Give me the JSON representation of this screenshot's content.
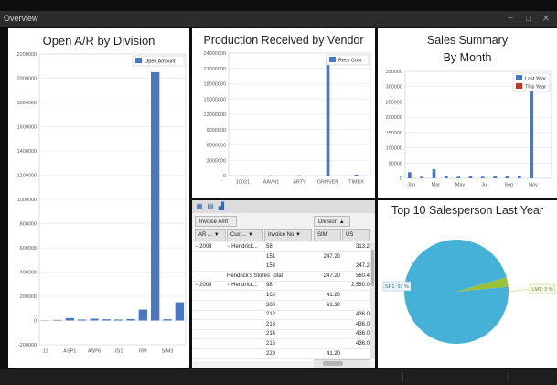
{
  "window": {
    "title": "Overview",
    "minimize_icon": "minimize-icon",
    "maximize_icon": "maximize-icon",
    "close_icon": "close-icon"
  },
  "colors": {
    "bar_blue": "#4a76c2",
    "bar_red": "#c0392b",
    "pie_blue": "#45b1d6",
    "pie_green": "#9bc13c"
  },
  "chart_data": [
    {
      "id": "open_ar",
      "type": "bar",
      "title": "Open A/R by Division",
      "legend": [
        "Open Amount"
      ],
      "legend_position": "top-right",
      "ylim": [
        -200000,
        2200000
      ],
      "yticks": [
        -200000,
        0,
        200000,
        400000,
        600000,
        800000,
        1000000,
        1200000,
        1400000,
        1600000,
        1800000,
        2000000,
        2200000
      ],
      "ytick_labels": [
        "-200000",
        "0",
        "200000",
        "400000",
        "600000",
        "800000",
        "1000000",
        "1200000",
        "1400000",
        "1600000",
        "1800000",
        "2000000",
        "2200000"
      ],
      "xtick_labels": [
        "11",
        "ASP1",
        "ASP6",
        "JS1",
        "RM",
        "SIM3"
      ],
      "categories": [
        "11",
        "",
        "ASP1",
        "",
        "ASP6",
        "",
        "JS1",
        "",
        "RM",
        "",
        "SIM3",
        ""
      ],
      "series": [
        {
          "name": "Open Amount",
          "values": [
            2000,
            5000,
            20000,
            8000,
            15000,
            10000,
            8000,
            12000,
            90000,
            2050000,
            10000,
            150000
          ]
        }
      ],
      "grid": true
    },
    {
      "id": "production",
      "type": "bar",
      "title": "Production Received by Vendor",
      "legend": [
        "Recv Cost"
      ],
      "legend_position": "top-right",
      "ylim": [
        0,
        24000000
      ],
      "yticks": [
        0,
        3000000,
        6000000,
        9000000,
        12000000,
        15000000,
        18000000,
        21000000,
        24000000
      ],
      "ytick_labels": [
        "0",
        "3000000",
        "6000000",
        "9000000",
        "12000000",
        "15000000",
        "18000000",
        "21000000",
        "24000000"
      ],
      "categories": [
        "10021",
        "AAVN1",
        "ARTV",
        "GRNVEN",
        "TIMEX"
      ],
      "series": [
        {
          "name": "Recv Cost",
          "values": [
            30000,
            40000,
            60000,
            22700000,
            200000
          ]
        }
      ],
      "grid": true
    },
    {
      "id": "sales_summary",
      "type": "bar",
      "title": "Sales Summary",
      "subtitle": "By Month",
      "legend": [
        "Last Year",
        "This Year"
      ],
      "legend_position": "top-right",
      "ylim": [
        0,
        350000
      ],
      "yticks": [
        0,
        50000,
        100000,
        150000,
        200000,
        250000,
        300000,
        350000
      ],
      "ytick_labels": [
        "0",
        "50000",
        "100000",
        "150000",
        "200000",
        "250000",
        "300000",
        "350000"
      ],
      "xtick_labels": [
        "Jan",
        "Mar",
        "May",
        "Jul",
        "Sep",
        "Nov"
      ],
      "categories": [
        "Jan",
        "Feb",
        "Mar",
        "Apr",
        "May",
        "Jun",
        "Jul",
        "Aug",
        "Sep",
        "Oct",
        "Nov",
        "Dec"
      ],
      "series": [
        {
          "name": "Last Year",
          "values": [
            20000,
            5000,
            30000,
            8000,
            5000,
            6000,
            5000,
            6000,
            7000,
            6000,
            315000,
            0
          ]
        },
        {
          "name": "This Year",
          "values": [
            0,
            0,
            0,
            0,
            0,
            0,
            0,
            0,
            0,
            0,
            0,
            0
          ]
        }
      ],
      "grid": true
    },
    {
      "id": "top_salesperson",
      "type": "pie",
      "title": "Top 10 Salesperson Last Year",
      "slices": [
        {
          "label": "SP1: 97 %",
          "value": 97
        },
        {
          "label": "LM1: 3 %",
          "value": 3
        }
      ]
    }
  ],
  "pivot": {
    "toolbar_icons": [
      "layout-icon",
      "grid-icon",
      "chart-icon"
    ],
    "data_field": "Invoice Amt",
    "column_field": "Division",
    "column_field_arrow": "▲",
    "row_headers": [
      "AR ...",
      "Cust...",
      "Invoice No"
    ],
    "row_header_arrows": [
      "▼",
      "▼",
      "▼"
    ],
    "value_columns": [
      "SIM",
      "US"
    ],
    "rows": [
      {
        "y1": "− 2008",
        "y2": "− Hendrick...",
        "inv": "58",
        "sim": "",
        "us": "313.2"
      },
      {
        "y1": "",
        "y2": "",
        "inv": "151",
        "sim": "247.20",
        "us": ""
      },
      {
        "y1": "",
        "y2": "",
        "inv": "153",
        "sim": "",
        "us": "247.2"
      },
      {
        "y1": "",
        "y2": "Hendrick's Stores Total",
        "inv": "",
        "sim": "247.20",
        "us": "560.4"
      },
      {
        "y1": "− 2009",
        "y2": "− Hendrick...",
        "inv": "98",
        "sim": "",
        "us": "2,560.0"
      },
      {
        "y1": "",
        "y2": "",
        "inv": "166",
        "sim": "41.20",
        "us": ""
      },
      {
        "y1": "",
        "y2": "",
        "inv": "200",
        "sim": "61.20",
        "us": ""
      },
      {
        "y1": "",
        "y2": "",
        "inv": "212",
        "sim": "",
        "us": "436.0"
      },
      {
        "y1": "",
        "y2": "",
        "inv": "213",
        "sim": "",
        "us": "436.0"
      },
      {
        "y1": "",
        "y2": "",
        "inv": "214",
        "sim": "",
        "us": "436.0"
      },
      {
        "y1": "",
        "y2": "",
        "inv": "215",
        "sim": "",
        "us": "436.0"
      },
      {
        "y1": "",
        "y2": "",
        "inv": "229",
        "sim": "41.20",
        "us": ""
      }
    ]
  }
}
